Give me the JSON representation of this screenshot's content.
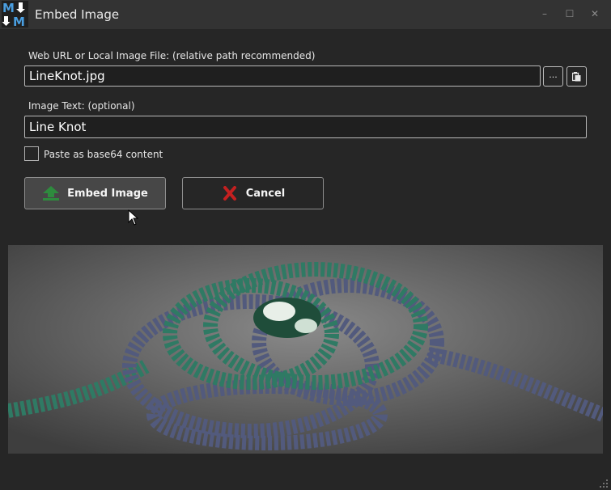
{
  "window": {
    "title": "Embed Image",
    "logo_text": "M↓M",
    "controls": {
      "minimize": "–",
      "maximize": "☐",
      "close": "✕"
    }
  },
  "form": {
    "url_label": "Web URL or Local Image File: (relative path recommended)",
    "url_value": "LineKnot.jpg",
    "browse_button": "...",
    "paste_button_icon": "clipboard-icon",
    "text_label": "Image Text: (optional)",
    "text_value": "Line Knot",
    "base64_checked": false,
    "base64_label": "Paste as base64 content"
  },
  "actions": {
    "embed_label": "Embed Image",
    "embed_icon": "upload-arrow-icon",
    "cancel_label": "Cancel",
    "cancel_icon": "red-x-icon"
  },
  "preview": {
    "description_icon": "rope-knot-image",
    "colors": {
      "background": "#4f4f4f",
      "rope_navy": "#525a7d",
      "rope_green": "#2f7a64",
      "accent_green": "#2e8b3e",
      "accent_red": "#c42020"
    }
  }
}
